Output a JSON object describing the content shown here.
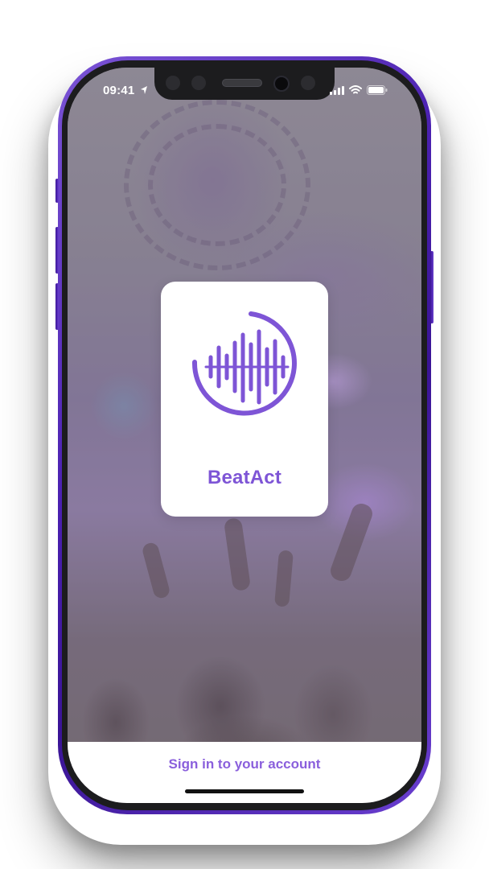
{
  "status_bar": {
    "time": "09:41",
    "location_icon": "location-arrow-icon",
    "signal_icon": "cellular-signal-icon",
    "wifi_icon": "wifi-icon",
    "battery_icon": "battery-icon"
  },
  "app": {
    "name": "BeatAct",
    "logo_icon": "sound-wave-circle-icon",
    "brand_color": "#7e55d6"
  },
  "footer": {
    "sign_in_label": "Sign in to your account"
  },
  "colors": {
    "frame": "#4a20b0",
    "accent": "#8a5fdc"
  }
}
